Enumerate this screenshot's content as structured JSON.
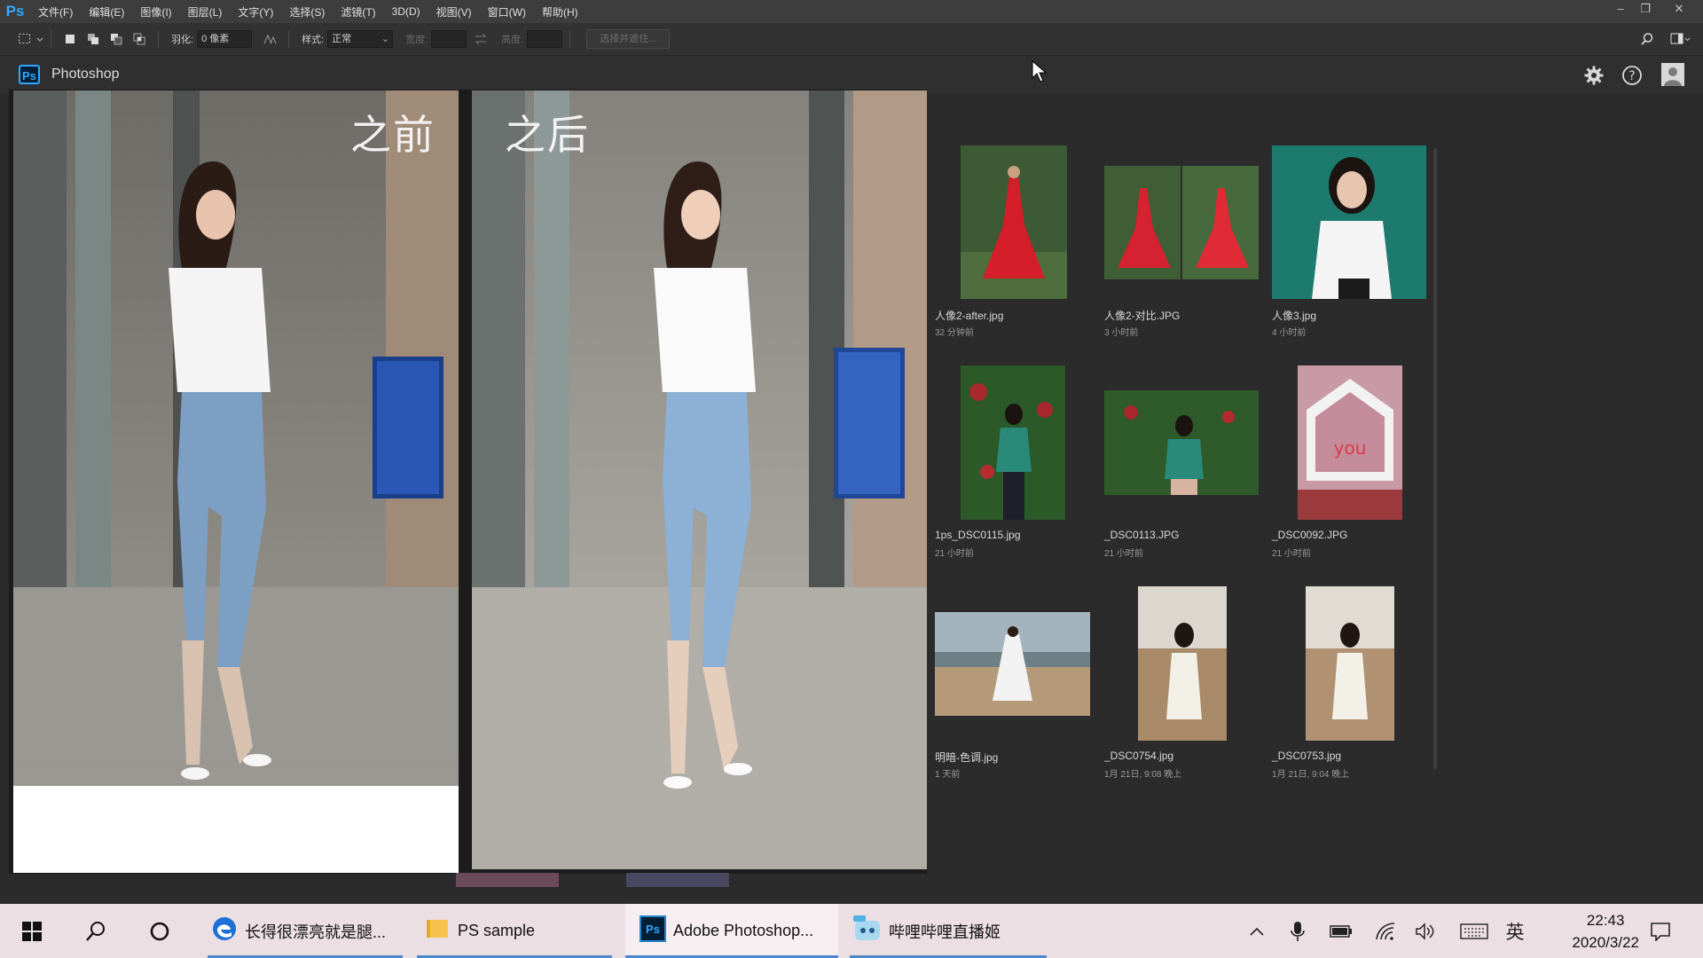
{
  "menubar": {
    "logo": "Ps",
    "items": [
      "文件(F)",
      "编辑(E)",
      "图像(I)",
      "图层(L)",
      "文字(Y)",
      "选择(S)",
      "滤镜(T)",
      "3D(D)",
      "视图(V)",
      "窗口(W)",
      "帮助(H)"
    ],
    "window_controls": [
      "–",
      "❐",
      "✕"
    ]
  },
  "options": {
    "feather_label": "羽化:",
    "feather_value": "0 像素",
    "style_label": "样式:",
    "style_value": "正常",
    "width_label": "宽度:",
    "height_label": "高度:",
    "select_mask_button": "选择并遮住..."
  },
  "home": {
    "ps_badge": "Ps",
    "title": "Photoshop"
  },
  "preview": {
    "before_label": "之前",
    "after_label": "之后"
  },
  "recent_files": [
    {
      "name": "人像2-after.jpg",
      "time": "32 分钟前"
    },
    {
      "name": "人像2-对比.JPG",
      "time": "3 小时前"
    },
    {
      "name": "人像3.jpg",
      "time": "4 小时前"
    },
    {
      "name": "1ps_DSC0115.jpg",
      "time": "21 小时前"
    },
    {
      "name": "_DSC0113.JPG",
      "time": "21 小时前"
    },
    {
      "name": "_DSC0092.JPG",
      "time": "21 小时前"
    },
    {
      "name": "明暗-色调.jpg",
      "time": "1 天前"
    },
    {
      "name": "_DSC0754.jpg",
      "time": "1月 21日, 9:08 晚上"
    },
    {
      "name": "_DSC0753.jpg",
      "time": "1月 21日, 9:04 晚上"
    }
  ],
  "taskbar": {
    "items": [
      {
        "label": "长得很漂亮就是腿...",
        "icon": "edge-icon"
      },
      {
        "label": "PS sample",
        "icon": "folder-icon"
      },
      {
        "label": "Adobe Photoshop...",
        "icon": "photoshop-icon"
      },
      {
        "label": "哔哩哔哩直播姬",
        "icon": "bilibili-live-icon"
      }
    ],
    "ime": "英",
    "time": "22:43",
    "date": "2020/3/22"
  },
  "colors": {
    "accent": "#31a8ff",
    "taskbar_bg": "#ecdfe3",
    "active_underline": "#4b88c9"
  }
}
